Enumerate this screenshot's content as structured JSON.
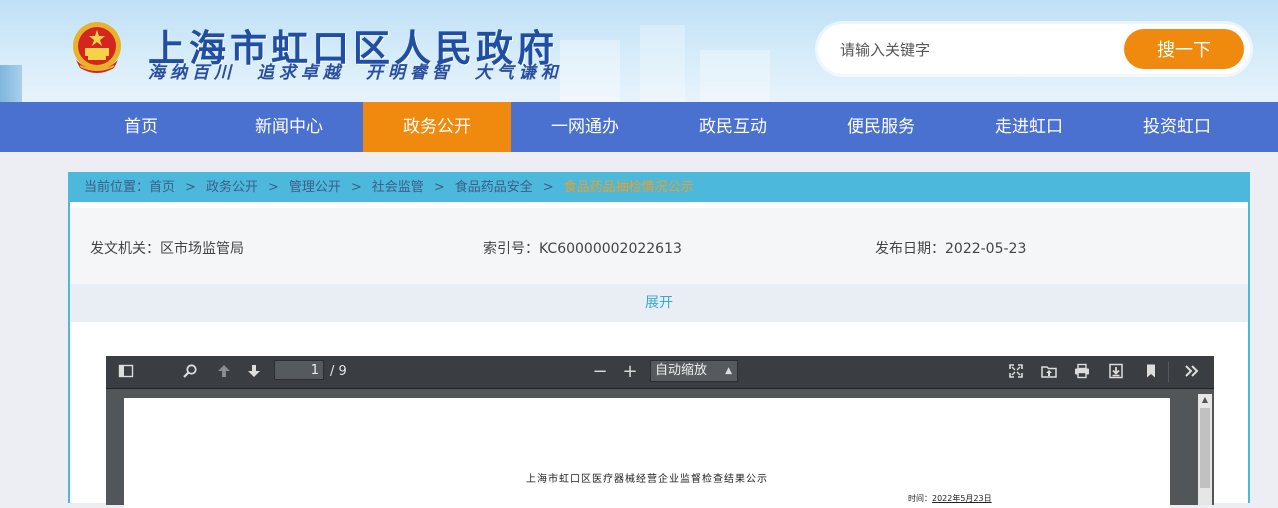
{
  "header": {
    "site_title": "上海市虹口区人民政府",
    "slogan": "海纳百川 追求卓越 开明睿智 大气谦和",
    "search": {
      "placeholder": "请输入关键字",
      "button": "搜一下"
    }
  },
  "nav": {
    "items": [
      "首页",
      "新闻中心",
      "政务公开",
      "一网通办",
      "政民互动",
      "便民服务",
      "走进虹口",
      "投资虹口"
    ],
    "active_index": 2
  },
  "breadcrumb": {
    "prefix": "当前位置：",
    "items": [
      "首页",
      "政务公开",
      "管理公开",
      "社会监管",
      "食品药品安全",
      "食品药品抽检情况公示"
    ],
    "separator": ">"
  },
  "meta": {
    "issuer": "发文机关：区市场监管局",
    "index_no": "索引号：KC60000002022613",
    "publish_date": "发布日期：2022-05-23"
  },
  "expand_label": "展开",
  "pdf_viewer": {
    "current_page": "1",
    "total_pages": "/ 9",
    "zoom_label": "自动缩放",
    "zoom_out": "−",
    "zoom_in": "+",
    "document_title": "上海市虹口区医疗器械经营企业监督检查结果公示",
    "date_prefix": "时间：",
    "date_value": "2022年5月23日"
  },
  "colors": {
    "nav_bg": "#4a70d0",
    "accent_orange": "#f08a0e",
    "breadcrumb_bg": "#4bb8dc",
    "title_blue": "#1f4ea3"
  }
}
